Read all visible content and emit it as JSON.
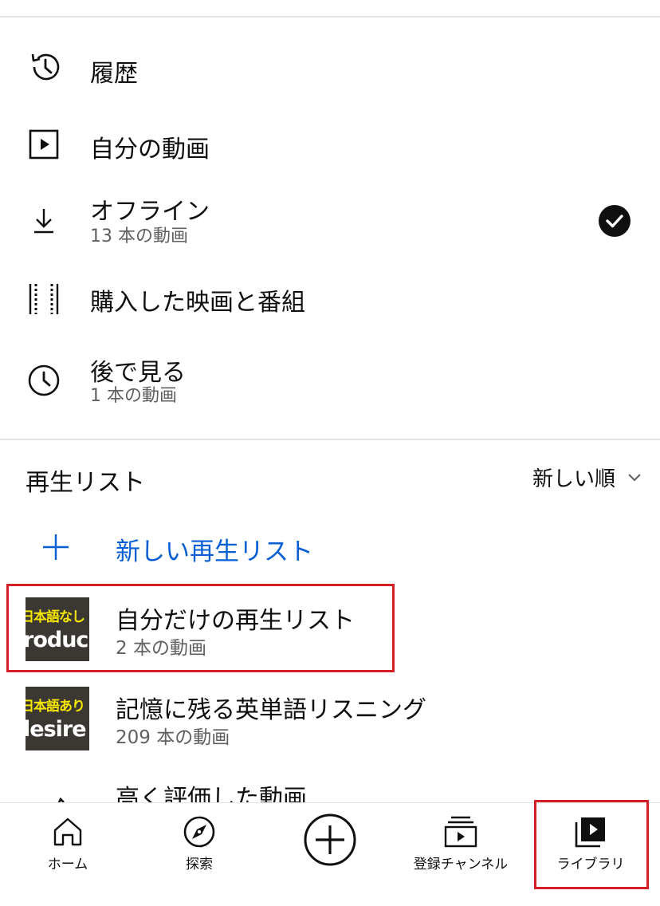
{
  "menu": {
    "history": {
      "label": "履歴",
      "icon": "history-icon"
    },
    "my_videos": {
      "label": "自分の動画",
      "icon": "play-square-icon"
    },
    "offline": {
      "label": "オフライン",
      "sub": "13 本の動画",
      "icon": "download-icon",
      "status_icon": "check-circle-icon"
    },
    "purchases": {
      "label": "購入した映画と番組",
      "icon": "film-strip-icon"
    },
    "watch_later": {
      "label": "後で見る",
      "sub": "1 本の動画",
      "icon": "clock-icon"
    }
  },
  "playlists": {
    "title": "再生リスト",
    "sort_label": "新しい順",
    "new_playlist_label": "新しい再生リスト",
    "items": [
      {
        "title": "自分だけの再生リスト",
        "count": "2 本の動画",
        "thumb_line1": "日本語なし",
        "thumb_line2": "roduc"
      },
      {
        "title": "記憶に残る英単語リスニング",
        "count": "209 本の動画",
        "thumb_line1": "日本語あり",
        "thumb_line2": "lesire"
      },
      {
        "title": "高く評価した動画"
      }
    ]
  },
  "bottom_nav": {
    "home": "ホーム",
    "explore": "探索",
    "subscriptions": "登録チャンネル",
    "library": "ライブラリ"
  },
  "colors": {
    "accent_blue": "#065fd4",
    "highlight_red": "#d32027",
    "secondary_text": "#606060",
    "thumb_yellow": "#f5e600"
  }
}
